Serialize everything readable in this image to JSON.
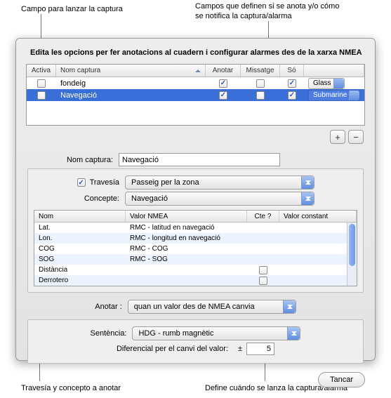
{
  "callouts": {
    "top_left": "Campo para lanzar la captura",
    "top_right_l1": "Campos que definen si se anota y/o cómo",
    "top_right_l2": "se notifica la captura/alarma",
    "bottom_left": "Travesía y concepto a anotar",
    "bottom_right": "Define cuándo se lanza la captura/alarma"
  },
  "title": "Edita les opcions per fer anotacions al cuadern i configurar alarmes des de la xarxa NMEA",
  "cols": {
    "activa": "Activa",
    "nom": "Nom captura",
    "anotar": "Anotar",
    "missatge": "Missatge",
    "so": "Só"
  },
  "rows": [
    {
      "nom": "fondeig",
      "activa": false,
      "anotar": true,
      "msg": false,
      "so": true,
      "sosel": "Glass",
      "sel": false
    },
    {
      "nom": "Navegació",
      "activa": false,
      "anotar": true,
      "msg": false,
      "so": true,
      "sosel": "Submarine",
      "sel": true
    }
  ],
  "add": "+",
  "remove": "−",
  "labels": {
    "nom": "Nom captura:",
    "trav": "Travesía",
    "conc": "Concepte:",
    "anotar": "Anotar :",
    "sent": "Sentència:",
    "diff": "Diferencial per el canvi del valor:",
    "pm": "±"
  },
  "values": {
    "nom": "Navegació",
    "trav": "Passeig per la zona",
    "conc": "Navegació",
    "anotar": "quan un valor des de NMEA canvia",
    "sent": "HDG - rumb magnètic",
    "diff": "5"
  },
  "cols2": {
    "nom": "Nom",
    "val": "Valor NMEA",
    "cte": "Cte ?",
    "const": "Valor constant"
  },
  "rows2": [
    {
      "nom": "Lat.",
      "val": "RMC - latitud en navegació",
      "cte": null
    },
    {
      "nom": "Lon.",
      "val": "RMC - longitud en navegació",
      "cte": null
    },
    {
      "nom": "COG",
      "val": "RMC - COG",
      "cte": null
    },
    {
      "nom": "SOG",
      "val": "RMC - SOG",
      "cte": null
    },
    {
      "nom": "Distància",
      "val": "",
      "cte": false
    },
    {
      "nom": "Derrotero",
      "val": "",
      "cte": false
    }
  ],
  "close": "Tancar"
}
